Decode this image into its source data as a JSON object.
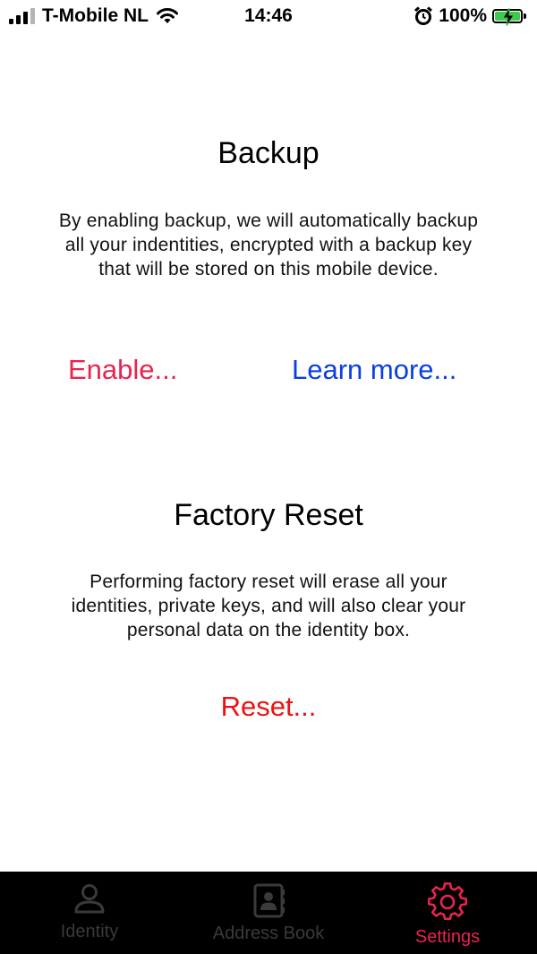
{
  "status_bar": {
    "carrier": "T-Mobile NL",
    "time": "14:46",
    "battery": "100%"
  },
  "backup": {
    "title": "Backup",
    "description": "By enabling backup, we will automatically backup all your indentities, encrypted with a backup key that will be stored on this mobile device.",
    "enable_label": "Enable...",
    "learn_more_label": "Learn more..."
  },
  "factory_reset": {
    "title": "Factory Reset",
    "description": "Performing factory reset will erase all your identities, private keys, and will also clear your personal data on the identity box.",
    "reset_label": "Reset..."
  },
  "tab_bar": {
    "tabs": [
      {
        "label": "Identity",
        "icon": "person-icon",
        "active": false
      },
      {
        "label": "Address Book",
        "icon": "address-book-icon",
        "active": false
      },
      {
        "label": "Settings",
        "icon": "gear-icon",
        "active": true
      }
    ]
  },
  "colors": {
    "accent": "#e8244f",
    "link": "#0a3fe0",
    "danger": "#ee1111"
  }
}
